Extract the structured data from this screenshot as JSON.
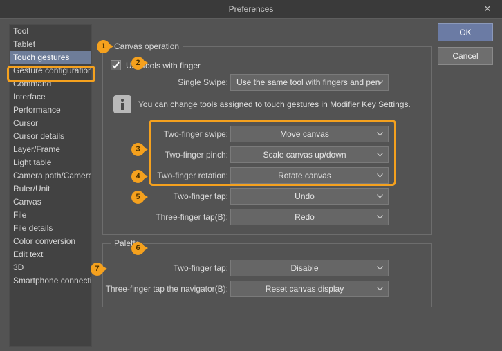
{
  "window": {
    "title": "Preferences",
    "close_icon": "close-icon"
  },
  "buttons": {
    "ok": "OK",
    "cancel": "Cancel"
  },
  "sidebar": {
    "selected": "Touch gestures",
    "items": [
      "Tool",
      "Tablet",
      "Touch gestures",
      "Gesture configuration",
      "Command",
      "Interface",
      "Performance",
      "Cursor",
      "Cursor details",
      "Layer/Frame",
      "Light table",
      "Camera path/Camera",
      "Ruler/Unit",
      "Canvas",
      "File",
      "File details",
      "Color conversion",
      "Edit text",
      "3D",
      "Smartphone connection"
    ]
  },
  "canvas_operation": {
    "legend": "Canvas operation",
    "use_tools_with_finger": {
      "label": "Use tools with finger",
      "checked": true
    },
    "info_note": "You can change tools assigned to touch gestures in Modifier Key Settings.",
    "rows": [
      {
        "label": "Single Swipe:",
        "value": "Use the same tool with fingers and pen"
      },
      {
        "label": "Two-finger swipe:",
        "value": "Move canvas"
      },
      {
        "label": "Two-finger pinch:",
        "value": "Scale canvas up/down"
      },
      {
        "label": "Two-finger rotation:",
        "value": "Rotate canvas"
      },
      {
        "label": "Two-finger tap:",
        "value": "Undo"
      },
      {
        "label": "Three-finger tap(B):",
        "value": "Redo"
      }
    ]
  },
  "palette": {
    "legend": "Palette",
    "rows": [
      {
        "label": "Two-finger tap:",
        "value": "Disable"
      },
      {
        "label": "Three-finger tap the navigator(B):",
        "value": "Reset canvas display"
      }
    ]
  },
  "annotations": {
    "badges": [
      "1",
      "2",
      "3",
      "4",
      "5",
      "6",
      "7"
    ],
    "highlight_color": "#f5a11e"
  }
}
